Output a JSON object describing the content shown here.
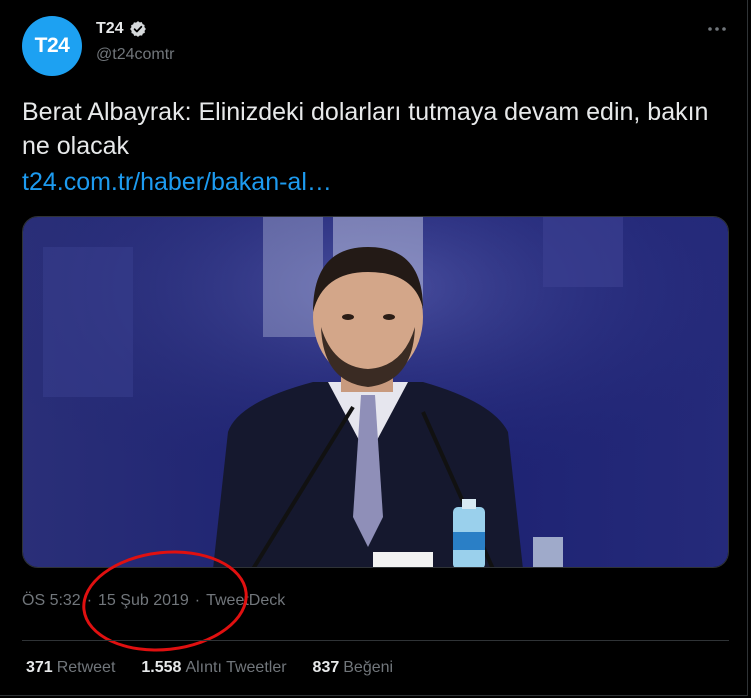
{
  "author": {
    "avatar_text": "T24",
    "name": "T24",
    "handle": "@t24comtr",
    "verified": true,
    "avatar_color": "#1da1f2"
  },
  "tweet": {
    "text": "Berat Albayrak: Elinizdeki dolarları tutmaya devam edin, bakın ne olacak",
    "link": "t24.com.tr/haber/bakan-al…"
  },
  "meta": {
    "time": "ÖS 5:32",
    "sep1": "·",
    "date": "15 Şub 2019",
    "sep2": "·",
    "source": "TweetDeck"
  },
  "stats": {
    "retweets": {
      "count": "371",
      "label": "Retweet"
    },
    "quotes": {
      "count": "1.558",
      "label": "Alıntı Tweetler"
    },
    "likes": {
      "count": "837",
      "label": "Beğeni"
    }
  },
  "icons": {
    "verified": "verified-badge-icon",
    "more": "more-options-icon"
  },
  "colors": {
    "background": "#000000",
    "text": "#e7e9ea",
    "muted": "#71767b",
    "link": "#1d9bf0",
    "highlight_circle": "#e01010"
  }
}
